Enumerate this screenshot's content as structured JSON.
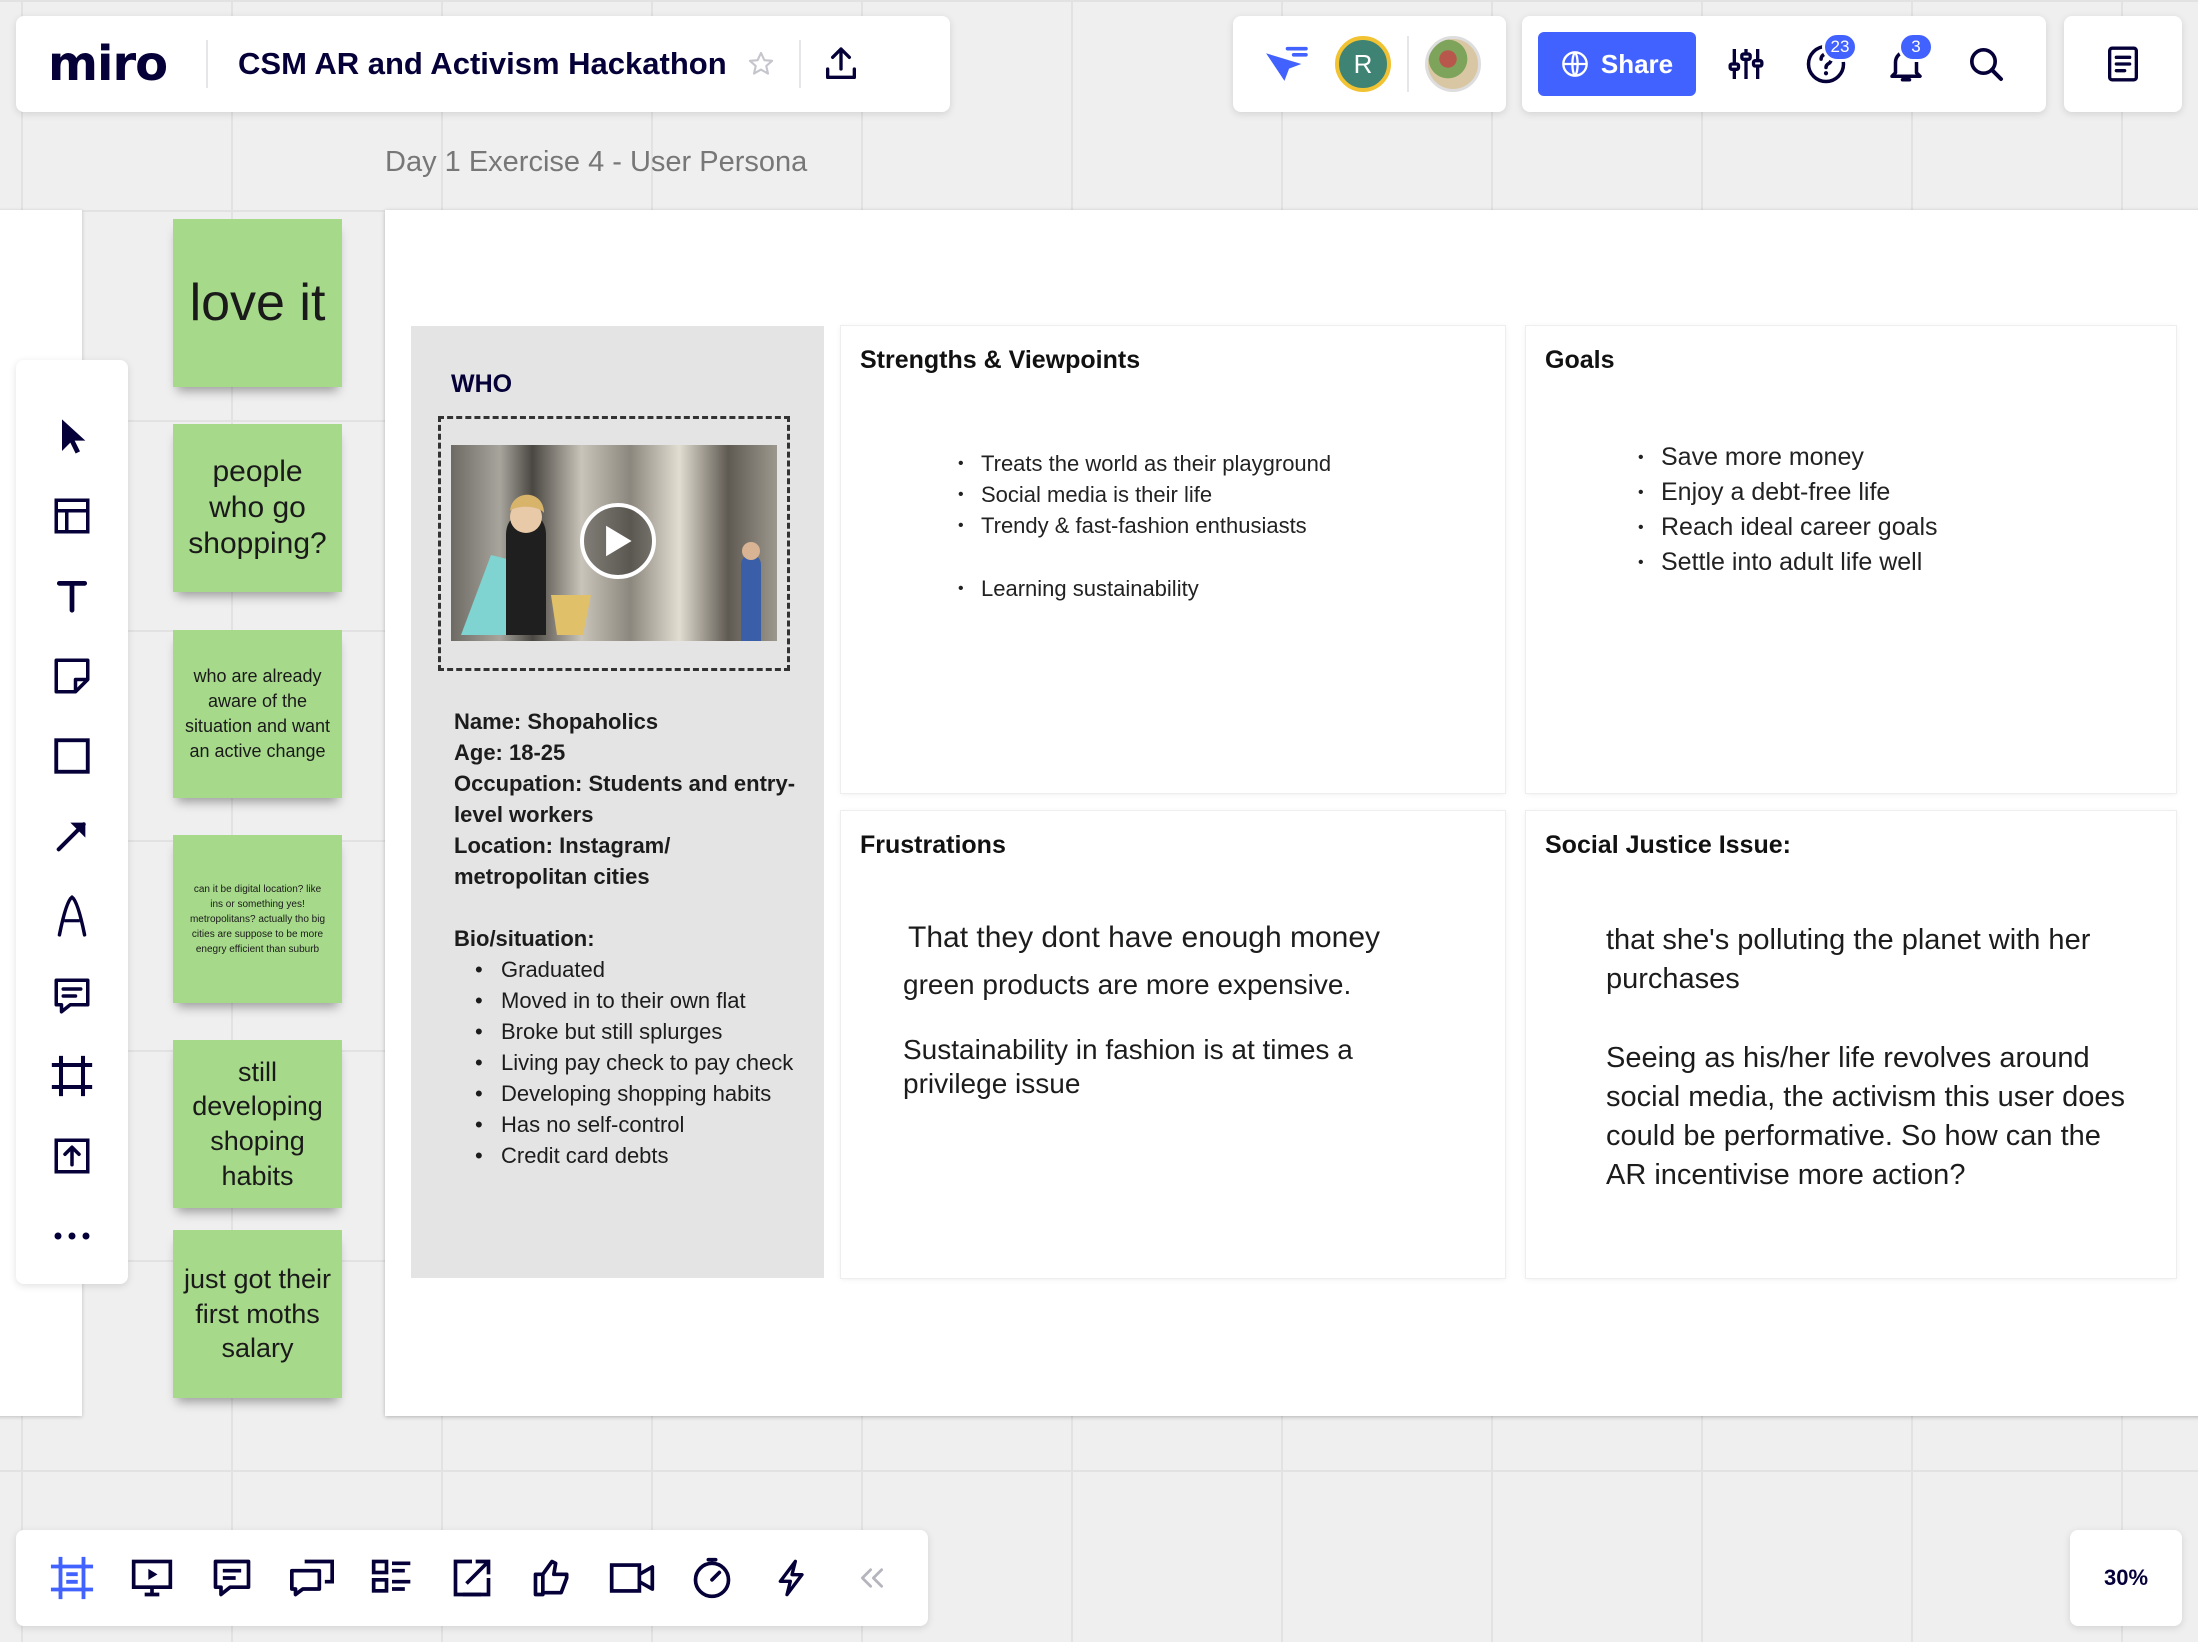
{
  "app": {
    "logo": "miro",
    "board_title": "CSM AR and Activism Hackathon"
  },
  "header": {
    "share_label": "Share",
    "collaborator_initial": "R",
    "help_badge": "23",
    "notification_badge": "3"
  },
  "frame": {
    "label": "Day 1 Exercise 4 - User Persona"
  },
  "stickies": [
    {
      "text": "love it"
    },
    {
      "text": "people who go shopping?"
    },
    {
      "text": "who are already aware of the situation and want an active change"
    },
    {
      "text": "can it be digital location? like ins or something yes! metropolitans? actually tho big cities are suppose to be more enegry efficient than suburb"
    },
    {
      "text": "still developing shoping habits"
    },
    {
      "text": "just got their first moths salary"
    }
  ],
  "who": {
    "title": "WHO",
    "name_line": "Name: Shopaholics",
    "age_line": "Age: 18-25",
    "occupation_line": "Occupation: Students and entry-level workers",
    "location_line": "Location: Instagram/ metropolitan cities",
    "bio_title": "Bio/situation:",
    "bio_items": [
      "Graduated",
      "Moved in to their own flat",
      "Broke but still splurges",
      "Living pay check to pay check",
      "Developing shopping habits",
      "Has no self-control",
      "Credit card debts"
    ]
  },
  "strengths": {
    "title": "Strengths & Viewpoints",
    "items": [
      "Treats the world as their playground",
      "Social media is their life",
      "Trendy & fast-fashion enthusiasts"
    ],
    "extra_item": "Learning sustainability"
  },
  "goals": {
    "title": "Goals",
    "items": [
      "Save more money",
      "Enjoy a debt-free life",
      "Reach ideal career goals",
      "Settle into adult life well"
    ]
  },
  "frustrations": {
    "title": "Frustrations",
    "line1": "That they dont have enough money",
    "line2": "green products are more expensive.",
    "line3": "Sustainability in fashion is at times a privilege issue"
  },
  "social_justice": {
    "title": "Social Justice Issue:",
    "para1": "that she's polluting the planet with her purchases",
    "para2": "Seeing as his/her life revolves around social media, the activism this user does could be performative. So how can the AR incentivise more action?"
  },
  "zoom": {
    "level": "30%"
  },
  "colors": {
    "accent": "#4262ff",
    "sticky": "#a6d98a",
    "ink": "#050038"
  }
}
